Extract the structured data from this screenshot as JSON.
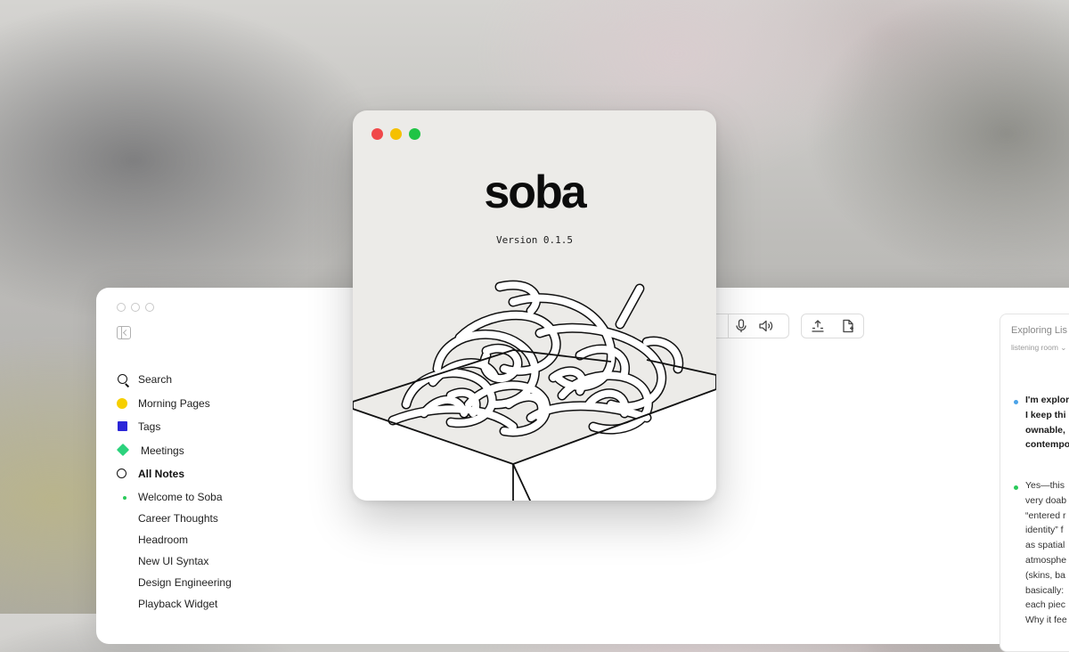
{
  "app": {
    "nav": [
      {
        "label": "Search",
        "icon": "search-icon"
      },
      {
        "label": "Morning Pages",
        "icon": "yellow-circle-icon",
        "color": "#f6cf00"
      },
      {
        "label": "Tags",
        "icon": "blue-square-icon",
        "color": "#2a25d8"
      },
      {
        "label": "Meetings",
        "icon": "green-diamond-icon",
        "color": "#2bd27c"
      },
      {
        "label": "All Notes",
        "icon": "ring-icon"
      }
    ],
    "notes": [
      {
        "label": "Welcome to Soba",
        "active": true
      },
      {
        "label": "Career Thoughts"
      },
      {
        "label": "Headroom"
      },
      {
        "label": "New UI Syntax"
      },
      {
        "label": "Design Engineering"
      },
      {
        "label": "Playback Widget"
      }
    ],
    "toolbar": {
      "group1": [
        "microphone-icon",
        "speaker-icon"
      ],
      "group2": [
        "export-icon",
        "new-document-icon"
      ]
    },
    "panel": {
      "title": "Exploring Lis",
      "subtitle": "listening room ⌄",
      "block1": [
        "I'm explor",
        "I keep thi",
        "ownable,",
        "contempo"
      ],
      "block2": [
        "Yes—this",
        "very doab",
        "“entered r",
        "identity” f",
        "as spatial",
        "atmosphe",
        "(skins, ba",
        "basically:",
        "each piec",
        "Why it fee"
      ],
      "bullet1_color": "#4aa3e8",
      "bullet2_color": "#2aca5a"
    }
  },
  "about": {
    "title": "soba",
    "version": "Version 0.1.5",
    "lights": [
      "#f0484a",
      "#f5c000",
      "#1fc445"
    ]
  }
}
